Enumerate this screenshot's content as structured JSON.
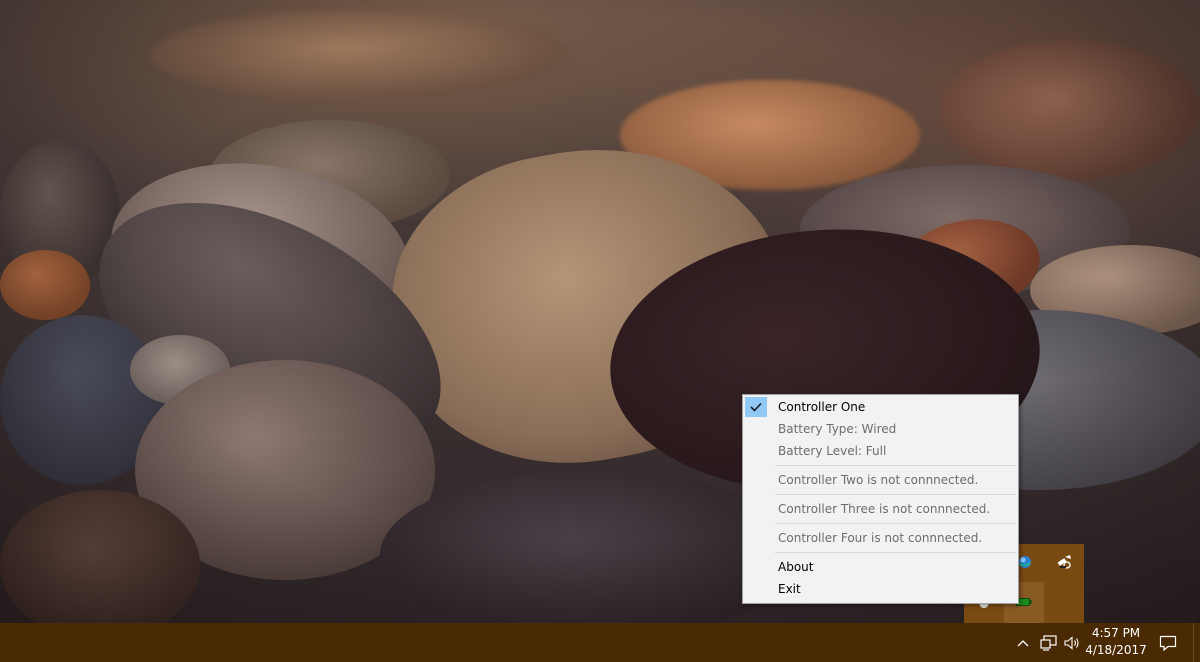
{
  "context_menu": {
    "items": [
      {
        "label": "Controller One",
        "checked": true,
        "enabled": true
      },
      {
        "label": "Battery Type: Wired",
        "enabled": false
      },
      {
        "label": "Battery Level: Full",
        "enabled": false
      },
      {
        "label": "Controller Two is not connnected.",
        "enabled": false
      },
      {
        "label": "Controller Three is not connnected.",
        "enabled": false
      },
      {
        "label": "Controller Four is not connnected.",
        "enabled": false
      },
      {
        "label": "About",
        "enabled": true
      },
      {
        "label": "Exit",
        "enabled": true
      }
    ]
  },
  "taskbar": {
    "clock": {
      "time": "4:57 PM",
      "date": "4/18/2017"
    },
    "tray_icons": [
      "chevron-up-icon",
      "network-icon",
      "volume-icon"
    ],
    "action_center": "notification-icon"
  },
  "tray_overflow": {
    "icons": [
      "blue-orb-icon",
      "satellite-icon",
      "gamepad-icon",
      "battery-indicator-icon"
    ]
  },
  "colors": {
    "taskbar": "#4a2a05",
    "tray_overflow": "#7a4a13",
    "menu_bg": "#f2f2f2",
    "check_highlight": "#90c8f6",
    "disabled_text": "#6d6d6d"
  }
}
